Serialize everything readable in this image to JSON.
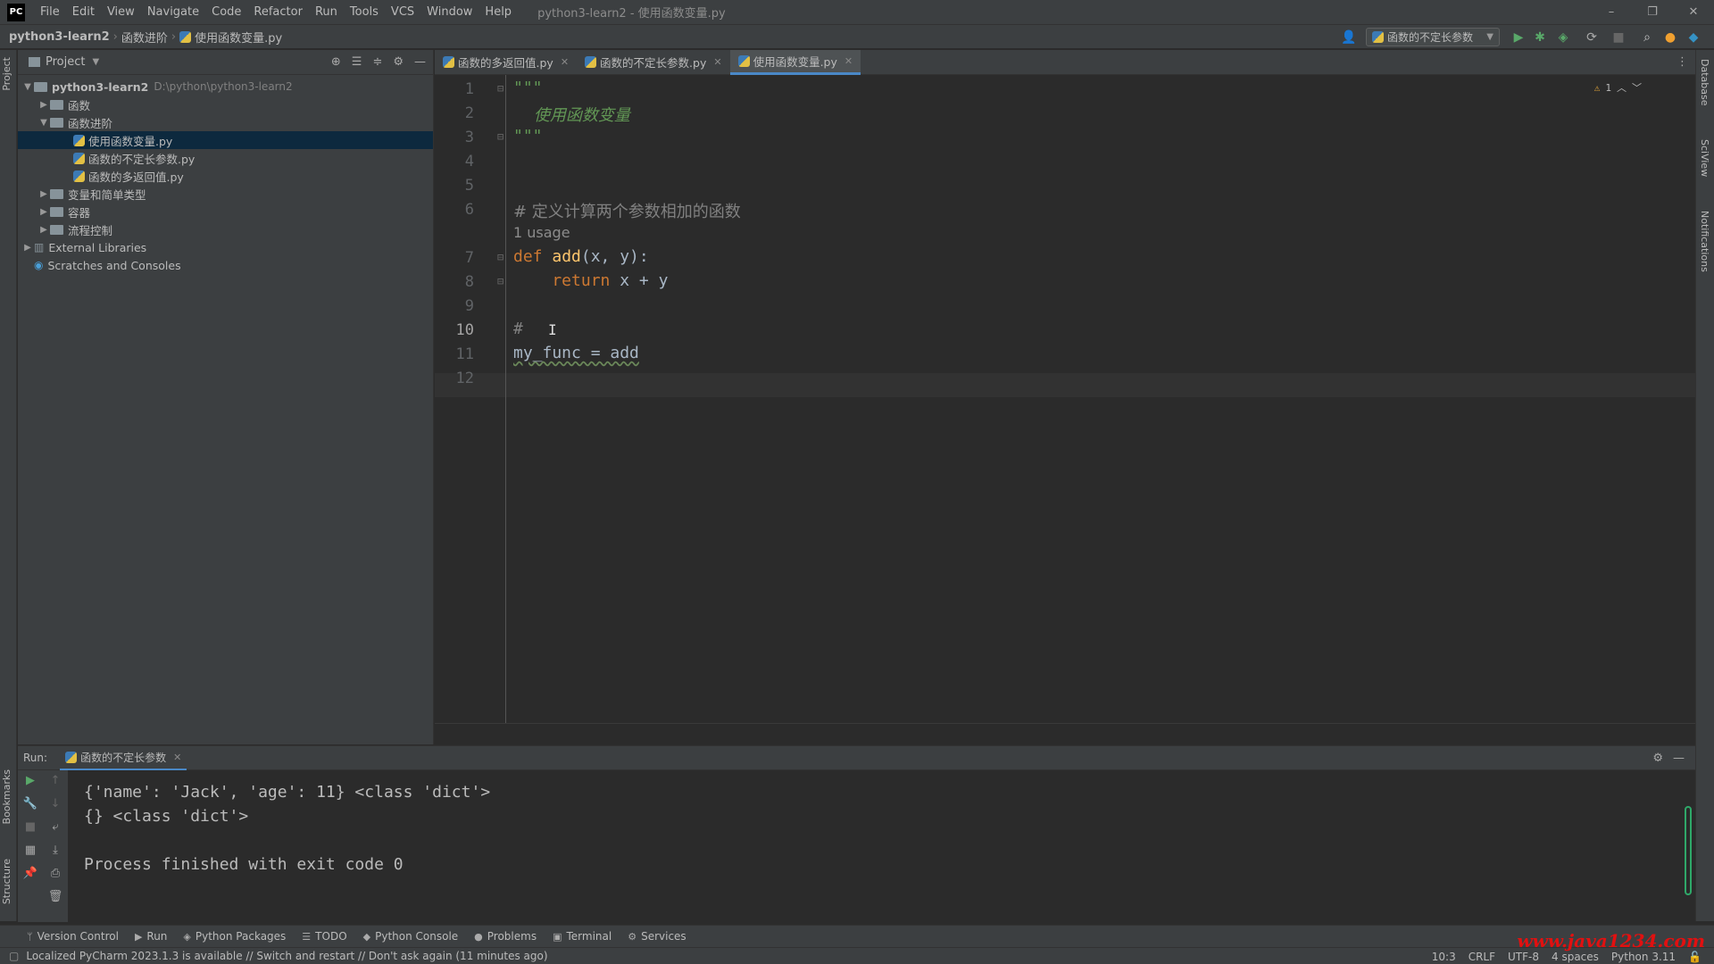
{
  "app": {
    "logo": "PC",
    "menu": [
      "File",
      "Edit",
      "View",
      "Navigate",
      "Code",
      "Refactor",
      "Run",
      "Tools",
      "VCS",
      "Window",
      "Help"
    ],
    "window_title": "python3-learn2 - 使用函数变量.py",
    "window_buttons": [
      "–",
      "❐",
      "✕"
    ]
  },
  "navbar": {
    "project": "python3-learn2",
    "folder": "函数进阶",
    "file": "使用函数变量.py",
    "run_config": "函数的不定长参数"
  },
  "project_panel": {
    "title": "Project",
    "tree": [
      {
        "label": "python3-learn2",
        "path": "D:\\python\\python3-learn2",
        "level": 0,
        "arrow": "▼"
      },
      {
        "label": "函数",
        "level": 1,
        "arrow": "▶"
      },
      {
        "label": "函数进阶",
        "level": 1,
        "arrow": "▼"
      },
      {
        "label": "使用函数变量.py",
        "level": 2,
        "arrow": ""
      },
      {
        "label": "函数的不定长参数.py",
        "level": 2,
        "arrow": ""
      },
      {
        "label": "函数的多返回值.py",
        "level": 2,
        "arrow": ""
      },
      {
        "label": "变量和简单类型",
        "level": 1,
        "arrow": "▶"
      },
      {
        "label": "容器",
        "level": 1,
        "arrow": "▶"
      },
      {
        "label": "流程控制",
        "level": 1,
        "arrow": "▶"
      },
      {
        "label": "External Libraries",
        "level": 0,
        "arrow": "▶"
      },
      {
        "label": "Scratches and Consoles",
        "level": 0,
        "arrow": ""
      }
    ]
  },
  "left_strip": {
    "project": "Project",
    "bookmarks": "Bookmarks",
    "structure": "Structure"
  },
  "right_strip": {
    "database": "Database",
    "sciview": "SciView",
    "notifications": "Notifications"
  },
  "editor": {
    "tabs": [
      {
        "label": "函数的多返回值.py",
        "active": false
      },
      {
        "label": "函数的不定长参数.py",
        "active": false
      },
      {
        "label": "使用函数变量.py",
        "active": true
      }
    ],
    "warning_count": "1",
    "line_numbers": [
      "1",
      "2",
      "3",
      "4",
      "5",
      "6",
      "7",
      "8",
      "9",
      "10",
      "11",
      "12"
    ],
    "current_line": "10",
    "code": {
      "l1": "\"\"\"",
      "l2": "    使用函数变量",
      "l3": "\"\"\"",
      "l6": "# 定义计算两个参数相加的函数",
      "usage": "1 usage",
      "l7_kw": "def ",
      "l7_fn": "add",
      "l7_rest": "(x, y):",
      "l8_kw": "    return ",
      "l8_rest": "x + y",
      "l10": "#",
      "l11": "my_func = add"
    }
  },
  "run": {
    "label": "Run:",
    "tab": "函数的不定长参数",
    "output": [
      "{'name': 'Jack', 'age': 11} <class 'dict'>",
      "{} <class 'dict'>",
      "",
      "Process finished with exit code 0"
    ]
  },
  "tool_windows": [
    "Version Control",
    "Run",
    "Python Packages",
    "TODO",
    "Python Console",
    "Problems",
    "Terminal",
    "Services"
  ],
  "status": {
    "message": "Localized PyCharm 2023.1.3 is available // Switch and restart // Don't ask again (11 minutes ago)",
    "position": "10:3",
    "line_sep": "CRLF",
    "encoding": "UTF-8",
    "indent": "4 spaces",
    "interpreter": "Python 3.11"
  },
  "watermark": "www.java1234.com"
}
